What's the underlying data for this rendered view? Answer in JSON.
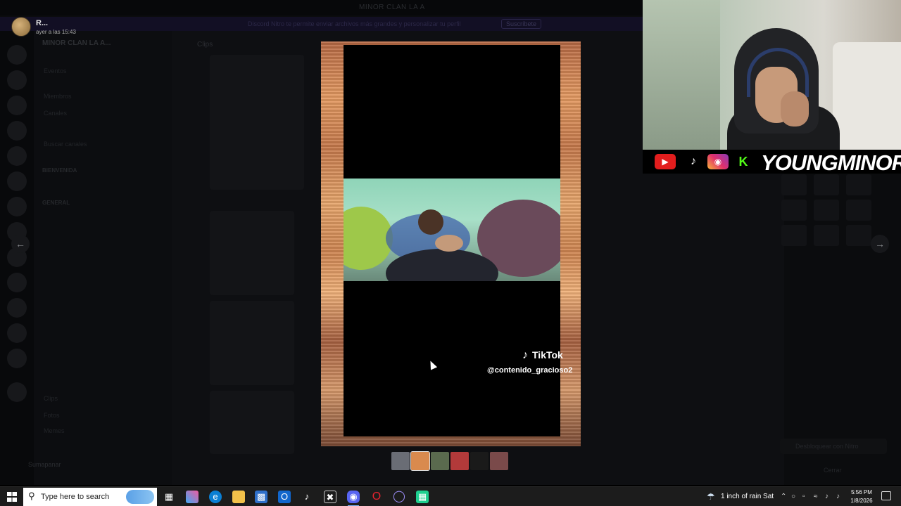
{
  "background": {
    "window_title": "MINOR CLAN LA A",
    "banner_text": "Discord Nitro te permite enviar archivos más grandes y personalizar tu perfil",
    "banner_button": "Suscríbete",
    "server_name": "MINOR CLAN LA A...",
    "channel_header": "Clips",
    "categories": [
      "BIENVENIDA",
      "GENERAL"
    ],
    "channels": [
      "Eventos",
      "Miembros",
      "Canales",
      "Buscar canales",
      "Clips",
      "Fotos",
      "Memes"
    ],
    "user_status": "Sumapanar",
    "nitro_button": "Desbloquear con Nitro",
    "close_label": "Cerrar"
  },
  "header": {
    "author": "R...",
    "timestamp": "ayer a las 15:43"
  },
  "viewer": {
    "prev_icon": "arrow-left-icon",
    "next_icon": "arrow-right-icon",
    "watermark_brand": "TikTok",
    "watermark_handle": "@contenido_gracioso2"
  },
  "thumbnails": [
    {
      "name": "thumb-1",
      "color": "#6a6d75",
      "selected": false
    },
    {
      "name": "thumb-2",
      "color": "#d98a4e",
      "selected": true
    },
    {
      "name": "thumb-3",
      "color": "#5a6a4e",
      "selected": false
    },
    {
      "name": "thumb-4",
      "color": "#b23a3a",
      "selected": false
    },
    {
      "name": "thumb-5",
      "color": "#1a1a1a",
      "selected": false
    },
    {
      "name": "thumb-6",
      "color": "#7a4a4a",
      "selected": false
    }
  ],
  "overlay": {
    "brand": "YOUNGMINOR",
    "socials": [
      "youtube-icon",
      "tiktok-icon",
      "instagram-icon",
      "kick-icon"
    ]
  },
  "taskbar": {
    "search_placeholder": "Type here to search",
    "weather": "1 inch of rain Sat",
    "time": "5:56 PM",
    "date": "1/8/2026"
  },
  "colors": {
    "youtube": "#e21d1d",
    "kick": "#53fc18",
    "accent": "#7fb8ff"
  }
}
